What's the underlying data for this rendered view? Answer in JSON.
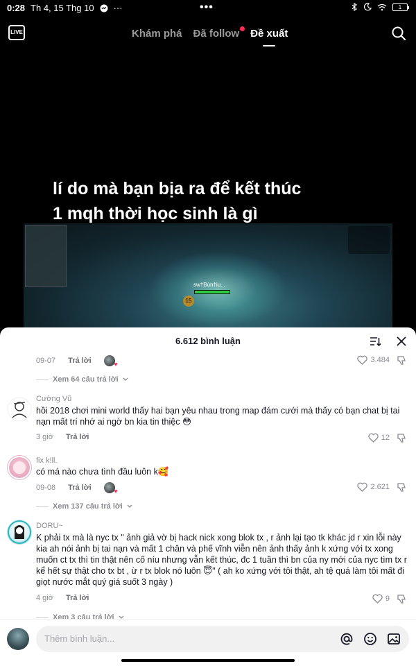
{
  "status_bar": {
    "time": "0:28",
    "date": "Th 4, 15 Thg 10",
    "center_dots": "•••",
    "battery": "1"
  },
  "top_nav": {
    "live_label": "LIVE",
    "tabs": [
      {
        "label": "Khám phá",
        "active": false
      },
      {
        "label": "Đã follow",
        "active": false,
        "has_notification_dot": true
      },
      {
        "label": "Đề xuất",
        "active": true
      }
    ]
  },
  "video": {
    "caption": "lí do mà bạn bịa ra để kết thúc 1 mqh thời học sinh là gì",
    "player_name": "sw†Bùn†iu...",
    "level": "15"
  },
  "comments_sheet": {
    "title": "6.612 bình luận",
    "first": {
      "time": "09-07",
      "reply_label": "Trả lời",
      "likes": "3.484",
      "view_replies": "Xem 64 câu trả lời"
    },
    "comments": [
      {
        "username": "Cường Vũ",
        "text": "hồi 2018 chơi mini world thấy hai bạn yêu nhau trong map đám cưới mà thấy có bạn chat bị tai nạn mất trí nhớ ai ngờ bn kia tin thiệc 😳",
        "time": "3 giờ",
        "reply_label": "Trả lời",
        "likes": "12"
      },
      {
        "username": "fix k!ll.",
        "text": "có má nào chưa tình đầu luôn k🥰",
        "time": "09-08",
        "reply_label": "Trả lời",
        "likes": "2.621",
        "view_replies": "Xem 137 câu trả lời"
      },
      {
        "username": "DORU~",
        "text": "K phải tx mà là nyc tx \" ảnh giả vờ bị hack nick xong blok tx , r ảnh lại tạo tk khác jd r xin lỗi này kia ah nói ảnh bị tai nạn và mất 1 chân và phế vĩnh viễn nên ảnh thấy ảnh k xứng với tx xong muốn ct tx thì tin thật nên cố níu nhưng vẫn kết thúc, đc 1 tuần thì bn của ny mới của nyc tìm tx r kể hết sự thật cho tx bt , ừ r tx blok nó luôn 😇\" ( ah ko xứng với tôi thật, ah tệ quá làm tôi mất đi giọt nước mắt quý giá suốt 3 ngày )",
        "time": "4 giờ",
        "reply_label": "Trả lời",
        "likes": "9",
        "view_replies": "Xem 3 câu trả lời"
      }
    ]
  },
  "input_bar": {
    "placeholder": "Thêm bình luận..."
  },
  "colors": {
    "accent": "#fe2c55",
    "text": "#161823",
    "muted": "#8a8b91"
  }
}
